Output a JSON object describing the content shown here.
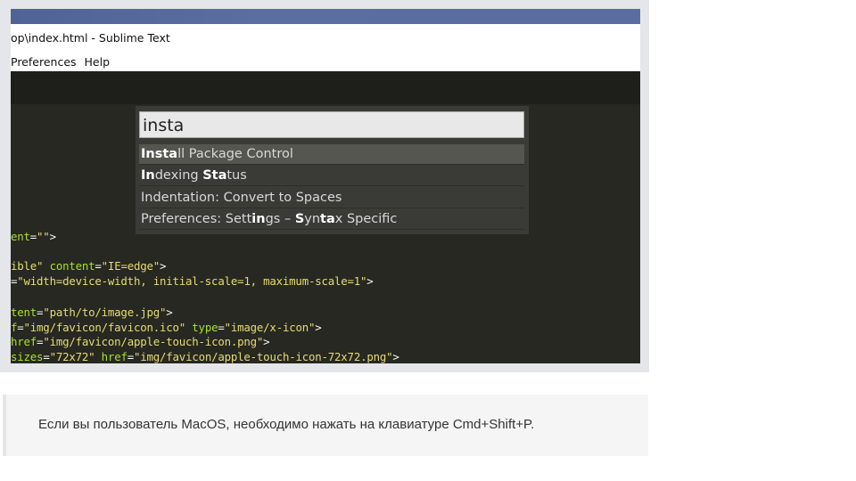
{
  "window": {
    "title": "op\\index.html - Sublime Text",
    "menu": [
      "Preferences",
      "Help"
    ]
  },
  "palette": {
    "query": "insta",
    "items": [
      [
        {
          "b": "Insta"
        },
        {
          "t": "ll Package Control"
        }
      ],
      [
        {
          "b": "In"
        },
        {
          "t": "dexing "
        },
        {
          "b": "Sta"
        },
        {
          "t": "tus"
        }
      ],
      [
        {
          "t": "Indentation: Convert to Spaces"
        }
      ],
      [
        {
          "t": "Preferences: Sett"
        },
        {
          "b": "in"
        },
        {
          "t": "gs – "
        },
        {
          "b": "S"
        },
        {
          "t": "yn"
        },
        {
          "b": "ta"
        },
        {
          "t": "x Specific"
        }
      ]
    ]
  },
  "code": [
    [
      {
        "c": "attr",
        "t": "ent"
      },
      {
        "c": "plain",
        "t": "="
      },
      {
        "c": "str",
        "t": "\"\""
      },
      {
        "c": "plain",
        "t": ">"
      }
    ],
    [
      {
        "c": "str",
        "t": "ible\""
      },
      {
        "c": "plain",
        "t": " "
      },
      {
        "c": "attr",
        "t": "content"
      },
      {
        "c": "plain",
        "t": "="
      },
      {
        "c": "str",
        "t": "\"IE=edge\""
      },
      {
        "c": "plain",
        "t": ">"
      }
    ],
    [
      {
        "c": "plain",
        "t": "="
      },
      {
        "c": "str",
        "t": "\"width=device-width, initial-scale=1, maximum-scale=1\""
      },
      {
        "c": "plain",
        "t": ">"
      }
    ],
    [
      {
        "c": "attr",
        "t": "tent"
      },
      {
        "c": "plain",
        "t": "="
      },
      {
        "c": "str",
        "t": "\"path/to/image.jpg\""
      },
      {
        "c": "plain",
        "t": ">"
      }
    ],
    [
      {
        "c": "attr",
        "t": "f"
      },
      {
        "c": "plain",
        "t": "="
      },
      {
        "c": "str",
        "t": "\"img/favicon/favicon.ico\""
      },
      {
        "c": "plain",
        "t": " "
      },
      {
        "c": "attr",
        "t": "type"
      },
      {
        "c": "plain",
        "t": "="
      },
      {
        "c": "str",
        "t": "\"image/x-icon\""
      },
      {
        "c": "plain",
        "t": ">"
      }
    ],
    [
      {
        "c": "attr",
        "t": "href"
      },
      {
        "c": "plain",
        "t": "="
      },
      {
        "c": "str",
        "t": "\"img/favicon/apple-touch-icon.png\""
      },
      {
        "c": "plain",
        "t": ">"
      }
    ],
    [
      {
        "c": "attr",
        "t": "sizes"
      },
      {
        "c": "plain",
        "t": "="
      },
      {
        "c": "str",
        "t": "\"72x72\""
      },
      {
        "c": "plain",
        "t": " "
      },
      {
        "c": "attr",
        "t": "href"
      },
      {
        "c": "plain",
        "t": "="
      },
      {
        "c": "str",
        "t": "\"img/favicon/apple-touch-icon-72x72.png\""
      },
      {
        "c": "plain",
        "t": ">"
      }
    ]
  ],
  "note": "Если вы пользователь MacOS, необходимо нажать на клавиатуре Cmd+Shift+P."
}
